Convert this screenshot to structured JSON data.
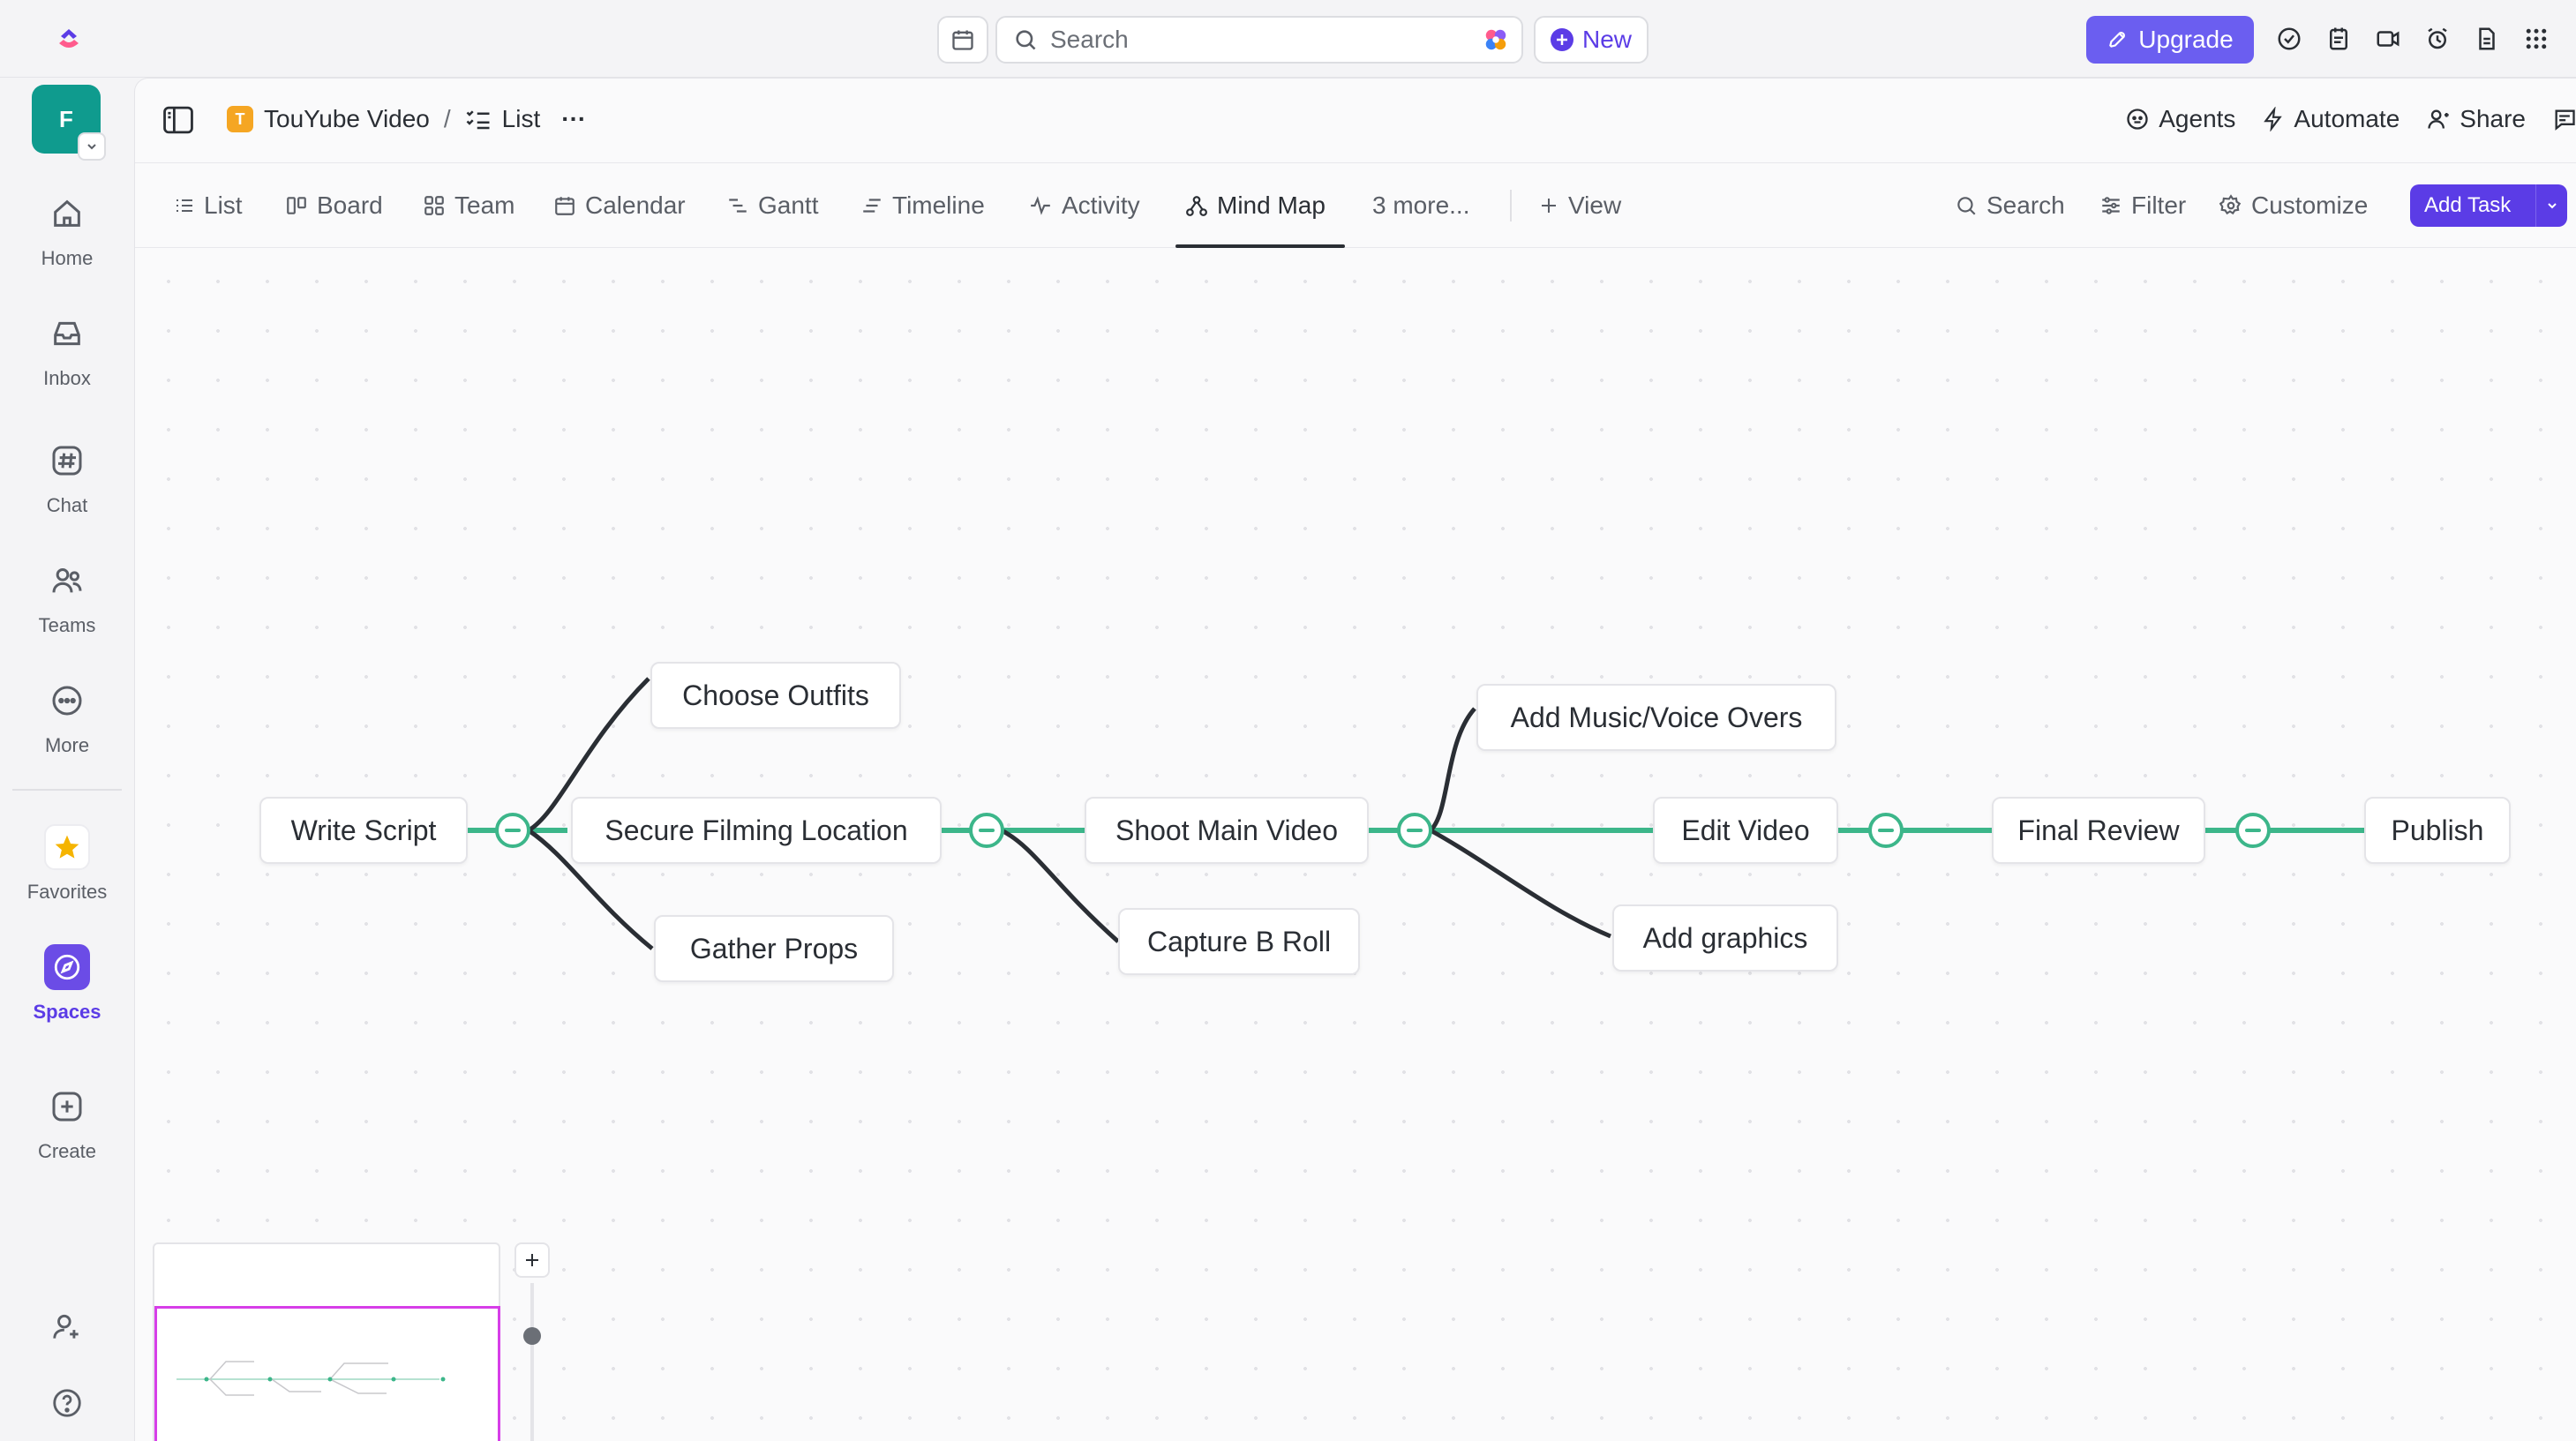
{
  "topbar": {
    "search_placeholder": "Search",
    "new_label": "New",
    "upgrade_label": "Upgrade",
    "icons": [
      "check-circle-icon",
      "notepad-icon",
      "video-icon",
      "alarm-icon",
      "document-icon",
      "apps-grid-icon"
    ]
  },
  "workspace": {
    "initial": "F",
    "color": "#0f9b8e"
  },
  "rail": {
    "items": [
      {
        "label": "Home",
        "icon": "home-icon"
      },
      {
        "label": "Inbox",
        "icon": "inbox-icon"
      },
      {
        "label": "Chat",
        "icon": "hash-icon"
      },
      {
        "label": "Teams",
        "icon": "users-icon"
      },
      {
        "label": "More",
        "icon": "more-icon"
      }
    ],
    "favorites_label": "Favorites",
    "spaces_label": "Spaces",
    "create_label": "Create"
  },
  "breadcrumb": {
    "space_badge": "T",
    "space_name": "TouYube Video",
    "separator": "/",
    "list_name": "List",
    "more": "···"
  },
  "header_actions": {
    "agents": "Agents",
    "automate": "Automate",
    "share": "Share"
  },
  "tabs": [
    {
      "label": "List",
      "icon": "list-icon"
    },
    {
      "label": "Board",
      "icon": "board-icon"
    },
    {
      "label": "Team",
      "icon": "team-grid-icon"
    },
    {
      "label": "Calendar",
      "icon": "calendar-icon"
    },
    {
      "label": "Gantt",
      "icon": "gantt-icon"
    },
    {
      "label": "Timeline",
      "icon": "timeline-icon"
    },
    {
      "label": "Activity",
      "icon": "activity-icon"
    },
    {
      "label": "Mind Map",
      "icon": "mindmap-icon",
      "active": true
    },
    {
      "label": "3 more...",
      "icon": ""
    }
  ],
  "add_view_label": "View",
  "toolbar": {
    "search": "Search",
    "filter": "Filter",
    "customize": "Customize",
    "add_task": "Add Task"
  },
  "mind_map": {
    "nodes": [
      {
        "id": "write-script",
        "label": "Write Script"
      },
      {
        "id": "choose-outfits",
        "label": "Choose Outfits"
      },
      {
        "id": "secure-filming-location",
        "label": "Secure Filming Location"
      },
      {
        "id": "gather-props",
        "label": "Gather Props"
      },
      {
        "id": "shoot-main-video",
        "label": "Shoot Main Video"
      },
      {
        "id": "capture-b-roll",
        "label": "Capture B Roll"
      },
      {
        "id": "add-music-voice-overs",
        "label": "Add Music/Voice Overs"
      },
      {
        "id": "edit-video",
        "label": "Edit Video"
      },
      {
        "id": "add-graphics",
        "label": "Add graphics"
      },
      {
        "id": "final-review",
        "label": "Final Review"
      },
      {
        "id": "publish",
        "label": "Publish"
      }
    ],
    "colors": {
      "main_line": "#3cb68a",
      "branch_line": "#2a2e34",
      "minimap_frame": "#d63ee8"
    }
  }
}
